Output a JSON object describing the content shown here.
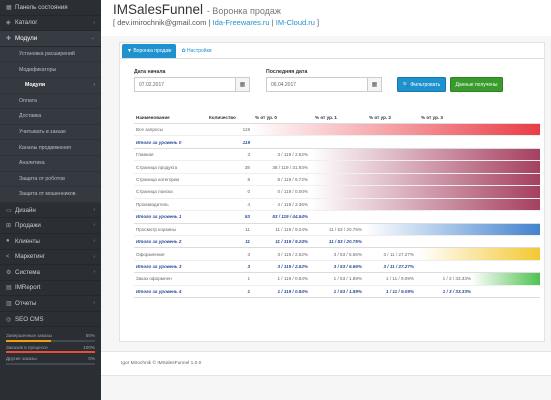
{
  "sidebar": {
    "items": [
      {
        "icon": "dashboard-icon",
        "glyph": "▦",
        "label": "Панель состояния"
      },
      {
        "icon": "tag-icon",
        "glyph": "◈",
        "label": "Каталог",
        "chev": "›"
      },
      {
        "icon": "puzzle-icon",
        "glyph": "✚",
        "label": "Модули",
        "chev": "⌄",
        "active": true
      }
    ],
    "sub_items": [
      {
        "label": "Установка расширений"
      },
      {
        "label": "Модификаторы"
      },
      {
        "label": "Модули",
        "current": true,
        "chev": "›"
      },
      {
        "label": "Оплата"
      },
      {
        "label": "Доставка"
      },
      {
        "label": "Учитывать в заказе"
      },
      {
        "label": "Каналы продвижения"
      },
      {
        "label": "Аналитика"
      },
      {
        "label": "Защита от роботов"
      },
      {
        "label": "Защита от мошенников"
      }
    ],
    "bottom_items": [
      {
        "icon": "monitor-icon",
        "glyph": "▭",
        "label": "Дизайн",
        "chev": "›"
      },
      {
        "icon": "cart-icon",
        "glyph": "⊞",
        "label": "Продажи",
        "chev": "›"
      },
      {
        "icon": "user-icon",
        "glyph": "●",
        "label": "Клиенты",
        "chev": "›"
      },
      {
        "icon": "share-icon",
        "glyph": "<",
        "label": "Маркетинг",
        "chev": "›"
      },
      {
        "icon": "gear-icon",
        "glyph": "⚙",
        "label": "Система",
        "chev": "›"
      },
      {
        "icon": "report-icon",
        "glyph": "▤",
        "label": "IMReport"
      },
      {
        "icon": "bar-chart-icon",
        "glyph": "▥",
        "label": "Отчеты",
        "chev": "›"
      },
      {
        "icon": "seo-icon",
        "glyph": "◎",
        "label": "SEO CMS"
      }
    ],
    "stats": [
      {
        "label": "Завершенные заказы",
        "value": "50%",
        "fraction": 0.5,
        "color": "#f39c12"
      },
      {
        "label": "Заказов в процессе",
        "value": "100%",
        "fraction": 1.0,
        "color": "#e74c3c"
      },
      {
        "label": "Другие заказы",
        "value": "0%",
        "fraction": 0.0,
        "color": "#3498db"
      }
    ]
  },
  "header": {
    "title": "IMSalesFunnel",
    "subtitle": "- Воронка продаж",
    "bracket_open": "[",
    "email": "dev.imirochnik@gmail.com",
    "sep": "|",
    "link1": "Ida-Freewares.ru",
    "link2": "IM-Cloud.ru",
    "bracket_close": "]"
  },
  "tabs": [
    {
      "label": "▼ Воронка продаж",
      "active": true
    },
    {
      "label": "✿ Настройки",
      "active": false
    }
  ],
  "filters": {
    "start_label": "Дата начала",
    "start_value": "07.02.2017",
    "end_label": "Последняя дата",
    "end_value": "06.04.2017",
    "calendar_glyph": "▦",
    "filter_button": "🔍 Фильтровать",
    "data_button": "Данные получены"
  },
  "table": {
    "headers": [
      "Наименование",
      "Количество",
      "% от ур. 0",
      "% от ур. 1",
      "% от ур. 2",
      "% от ур. 3"
    ],
    "rows": [
      {
        "name": "Все запросы",
        "count": "119",
        "p0": "",
        "p1": "",
        "p2": "",
        "p3": "",
        "total": false,
        "band": "red",
        "share": 1.0
      },
      {
        "name": "Итого за уровень 0",
        "count": "119",
        "p0": "",
        "p1": "",
        "p2": "",
        "p3": "",
        "total": true
      },
      {
        "name": "Главная",
        "count": "3",
        "p0": "3 / 119 / 2.52%",
        "p1": "",
        "p2": "",
        "p3": "",
        "total": false,
        "band": "purple",
        "share": 0.0252
      },
      {
        "name": "Страница продукта",
        "count": "38",
        "p0": "38 / 119 / 31.93%",
        "p1": "",
        "p2": "",
        "p3": "",
        "total": false,
        "band": "purple",
        "share": 0.3193
      },
      {
        "name": "Страница категории",
        "count": "8",
        "p0": "8 / 119 / 6.72%",
        "p1": "",
        "p2": "",
        "p3": "",
        "total": false,
        "band": "purple",
        "share": 0.0672
      },
      {
        "name": "Страница поиска",
        "count": "0",
        "p0": "0 / 119 / 0.00%",
        "p1": "",
        "p2": "",
        "p3": "",
        "total": false,
        "band": "purple",
        "share": 0.0
      },
      {
        "name": "Производитель",
        "count": "4",
        "p0": "4 / 119 / 3.36%",
        "p1": "",
        "p2": "",
        "p3": "",
        "total": false,
        "band": "purple",
        "share": 0.0336
      },
      {
        "name": "Итого за уровень 1",
        "count": "53",
        "p0": "53 / 119 / 44.54%",
        "p1": "",
        "p2": "",
        "p3": "",
        "total": true
      },
      {
        "name": "Просмотр корзины",
        "count": "11",
        "p0": "11 / 119 / 9.24%",
        "p1": "11 / 53 / 20.75%",
        "p2": "",
        "p3": "",
        "total": false,
        "band": "blue",
        "share": 0.0924
      },
      {
        "name": "Итого за уровень 2",
        "count": "11",
        "p0": "11 / 119 / 9.24%",
        "p1": "11 / 53 / 20.75%",
        "p2": "",
        "p3": "",
        "total": true
      },
      {
        "name": "Оформление",
        "count": "3",
        "p0": "3 / 119 / 2.52%",
        "p1": "3 / 53 / 5.66%",
        "p2": "3 / 11 / 27.27%",
        "p3": "",
        "total": false,
        "band": "yellow",
        "share": 0.0252
      },
      {
        "name": "Итого за уровень 3",
        "count": "3",
        "p0": "3 / 119 / 2.52%",
        "p1": "3 / 53 / 5.66%",
        "p2": "3 / 11 / 27.27%",
        "p3": "",
        "total": true
      },
      {
        "name": "Заказ оформлен",
        "count": "1",
        "p0": "1 / 119 / 0.84%",
        "p1": "1 / 53 / 1.89%",
        "p2": "1 / 11 / 9.09%",
        "p3": "1 / 3 / 33.33%",
        "total": false,
        "band": "green",
        "share": 0.0084
      },
      {
        "name": "Итого за уровень 4",
        "count": "1",
        "p0": "1 / 119 / 0.84%",
        "p1": "1 / 53 / 1.89%",
        "p2": "1 / 11 / 9.09%",
        "p3": "1 / 3 / 33.33%",
        "total": true
      }
    ]
  },
  "footer": {
    "text": "Igor Mirochnik © IMSalesFunnel 1.0.0"
  },
  "colors": {
    "sidebar_bg": "#2b2f33",
    "accent": "#1e91cf",
    "success": "#3a9b2d",
    "band_red": "#e8323c",
    "band_purple": "#9b2a4e",
    "band_blue": "#2f75c9",
    "band_yellow": "#f2c21a",
    "band_green": "#3cbb3c"
  }
}
